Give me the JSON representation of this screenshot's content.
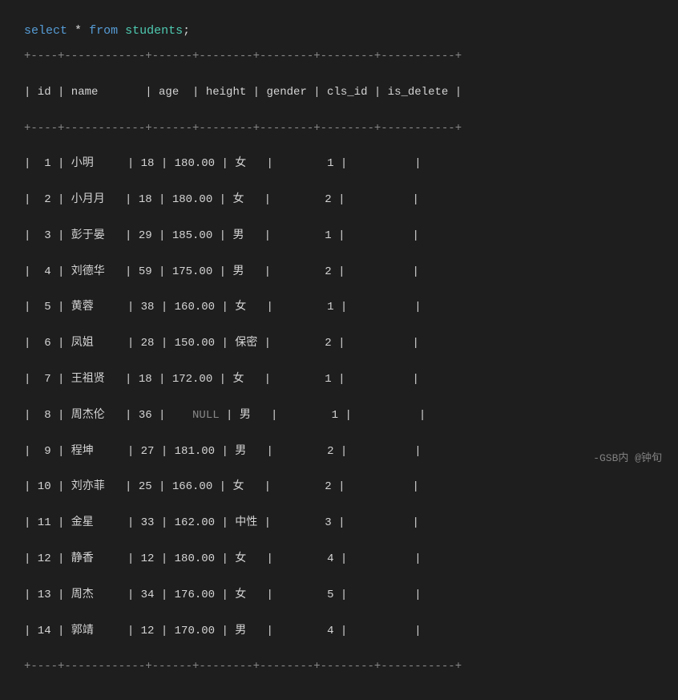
{
  "query": {
    "keyword1": "select",
    "operator": "*",
    "keyword2": "from",
    "table": "students",
    "semicolon": ";"
  },
  "table": {
    "divider": "+----+------------+------+--------+--------+--------+-----------+",
    "headers": [
      "id",
      "name",
      "age",
      "height",
      "gender",
      "cls_id",
      "is_delete"
    ],
    "rows": [
      {
        "id": "1",
        "name": "小明",
        "age": "18",
        "height": "180.00",
        "gender": "女",
        "cls_id": "1",
        "is_delete": ""
      },
      {
        "id": "2",
        "name": "小月月",
        "age": "18",
        "height": "180.00",
        "gender": "女",
        "cls_id": "2",
        "is_delete": ""
      },
      {
        "id": "3",
        "name": "彭于晏",
        "age": "29",
        "height": "185.00",
        "gender": "男",
        "cls_id": "1",
        "is_delete": ""
      },
      {
        "id": "4",
        "name": "刘德华",
        "age": "59",
        "height": "175.00",
        "gender": "男",
        "cls_id": "2",
        "is_delete": ""
      },
      {
        "id": "5",
        "name": "黄蓉",
        "age": "38",
        "height": "160.00",
        "gender": "女",
        "cls_id": "1",
        "is_delete": ""
      },
      {
        "id": "6",
        "name": "凤姐",
        "age": "28",
        "height": "150.00",
        "gender": "保密",
        "cls_id": "2",
        "is_delete": ""
      },
      {
        "id": "7",
        "name": "王祖贤",
        "age": "18",
        "height": "172.00",
        "gender": "女",
        "cls_id": "1",
        "is_delete": ""
      },
      {
        "id": "8",
        "name": "周杰伦",
        "age": "36",
        "height": "NULL",
        "gender": "男",
        "cls_id": "1",
        "is_delete": ""
      },
      {
        "id": "9",
        "name": "程坤",
        "age": "27",
        "height": "181.00",
        "gender": "男",
        "cls_id": "2",
        "is_delete": ""
      },
      {
        "id": "10",
        "name": "刘亦菲",
        "age": "25",
        "height": "166.00",
        "gender": "女",
        "cls_id": "2",
        "is_delete": ""
      },
      {
        "id": "11",
        "name": "金星",
        "age": "33",
        "height": "162.00",
        "gender": "中性",
        "cls_id": "3",
        "is_delete": ""
      },
      {
        "id": "12",
        "name": "静香",
        "age": "12",
        "height": "180.00",
        "gender": "女",
        "cls_id": "4",
        "is_delete": ""
      },
      {
        "id": "13",
        "name": "周杰",
        "age": "34",
        "height": "176.00",
        "gender": "女",
        "cls_id": "5",
        "is_delete": ""
      },
      {
        "id": "14",
        "name": "郭靖",
        "age": "12",
        "height": "170.00",
        "gender": "男",
        "cls_id": "4",
        "is_delete": ""
      }
    ]
  },
  "watermark": "-GSB内 @钟旬"
}
